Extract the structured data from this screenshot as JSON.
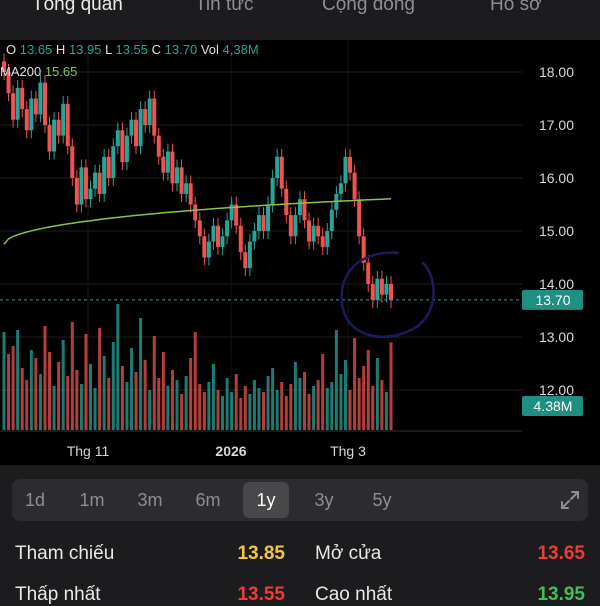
{
  "tabs": [
    "Tổng quan",
    "Tin tức",
    "Cộng đồng",
    "Hồ sơ"
  ],
  "legend": {
    "o_label": "O",
    "o": "13.65",
    "h_label": "H",
    "h": "13.95",
    "l_label": "L",
    "l": "13.55",
    "c_label": "C",
    "c": "13.70",
    "vol_label": "Vol",
    "vol": "4,38M",
    "ma_label": "MA200",
    "ma": "15.65"
  },
  "chart_data": {
    "type": "candlestick",
    "y_ticks": [
      "18.00",
      "17.00",
      "16.00",
      "15.00",
      "14.00",
      "13.00",
      "12.00"
    ],
    "ylim": [
      11.6,
      18.4
    ],
    "x_labels": [
      "Thg 11",
      "2026",
      "Thg 3"
    ],
    "current_price": "13.70",
    "current_volume": "4.38M",
    "ma200_label": "MA200",
    "ma200_last": 15.65,
    "closes": [
      18.0,
      17.6,
      17.1,
      17.7,
      17.3,
      16.9,
      17.5,
      17.2,
      17.8,
      17.0,
      16.5,
      17.1,
      16.8,
      17.4,
      16.6,
      16.0,
      15.5,
      16.2,
      15.6,
      15.8,
      16.1,
      15.7,
      16.4,
      16.0,
      16.6,
      16.9,
      16.3,
      16.8,
      17.1,
      16.6,
      17.3,
      17.0,
      17.5,
      16.8,
      16.4,
      16.1,
      16.5,
      15.9,
      16.2,
      15.7,
      15.9,
      15.5,
      15.2,
      14.9,
      14.5,
      14.8,
      15.1,
      14.7,
      14.9,
      15.2,
      15.5,
      15.1,
      14.6,
      14.3,
      14.8,
      15.0,
      15.3,
      15.0,
      15.5,
      16.0,
      16.4,
      15.8,
      15.3,
      14.9,
      15.3,
      15.6,
      15.2,
      14.8,
      15.1,
      14.9,
      14.7,
      15.0,
      15.4,
      15.7,
      15.9,
      16.4,
      16.1,
      15.6,
      14.9,
      14.4,
      14.0,
      13.7,
      14.1,
      13.8,
      14.0,
      13.7
    ],
    "volume_values": [
      4.9,
      3.8,
      4.2,
      5.0,
      3.1,
      2.5,
      4.0,
      3.6,
      2.8,
      5.2,
      3.9,
      2.2,
      3.4,
      4.5,
      2.7,
      5.4,
      3.0,
      2.3,
      4.8,
      3.3,
      2.1,
      5.1,
      3.7,
      2.6,
      4.4,
      6.3,
      3.2,
      2.4,
      4.1,
      2.9,
      5.6,
      3.5,
      2.0,
      4.7,
      2.6,
      3.9,
      2.2,
      3.0,
      2.5,
      1.8,
      2.7,
      3.6,
      4.9,
      2.3,
      1.9,
      2.4,
      3.3,
      2.0,
      1.7,
      2.6,
      1.9,
      2.8,
      1.6,
      2.2,
      1.8,
      2.5,
      2.1,
      1.9,
      2.7,
      3.1,
      2.0,
      2.4,
      1.7,
      2.3,
      3.4,
      2.6,
      2.9,
      1.8,
      2.2,
      2.5,
      3.8,
      2.1,
      2.4,
      5.0,
      2.8,
      3.5,
      2.0,
      4.6,
      2.6,
      3.2,
      4.0,
      2.2,
      3.6,
      2.5,
      1.9,
      4.38
    ],
    "annotation": "hand-drawn circle around latest candles"
  },
  "ranges": [
    "1d",
    "1m",
    "3m",
    "6m",
    "1y",
    "3y",
    "5y"
  ],
  "active_range": "1y",
  "stats": {
    "ref_label": "Tham chiếu",
    "ref": "13.85",
    "open_label": "Mở cửa",
    "open": "13.65",
    "low_label": "Thấp nhất",
    "low": "13.55",
    "high_label": "Cao nhất",
    "high": "13.95"
  },
  "colors": {
    "up": "#26a69a",
    "down": "#ef5350",
    "ma": "#8bc34a",
    "ref": "#f5c542",
    "bg": "#000000",
    "marker": "#1b1b5e"
  },
  "icons": {
    "expand": "expand-icon"
  }
}
